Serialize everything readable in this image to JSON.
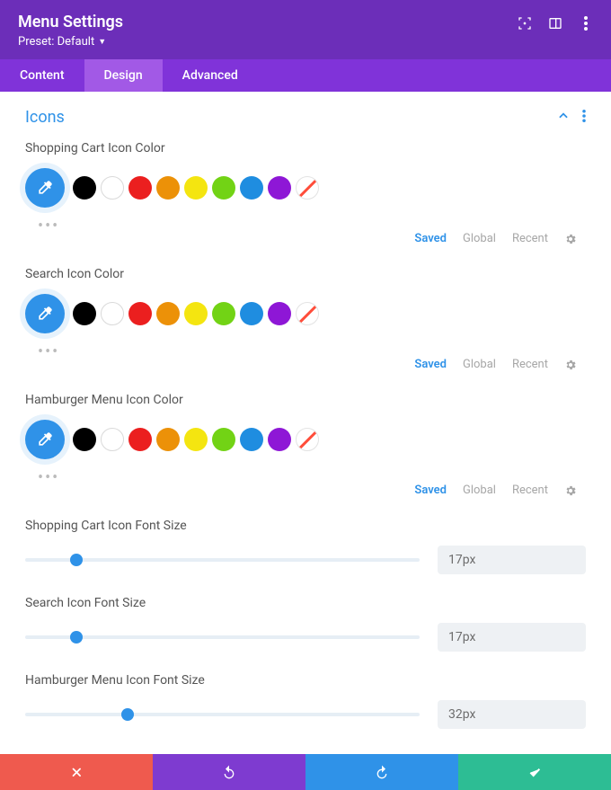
{
  "header": {
    "title": "Menu Settings",
    "preset_label": "Preset: Default"
  },
  "tabs": {
    "content": "Content",
    "design": "Design",
    "advanced": "Advanced"
  },
  "section": {
    "title": "Icons"
  },
  "swatch_palette": [
    "#000000",
    "#ffffff",
    "#eb1f1f",
    "#ec9108",
    "#f4e510",
    "#72d315",
    "#1f8de0",
    "#8e17d6"
  ],
  "color_fields": [
    {
      "label": "Shopping Cart Icon Color"
    },
    {
      "label": "Search Icon Color"
    },
    {
      "label": "Hamburger Menu Icon Color"
    }
  ],
  "palette_tabs": {
    "saved": "Saved",
    "global": "Global",
    "recent": "Recent"
  },
  "size_fields": [
    {
      "label": "Shopping Cart Icon Font Size",
      "value": "17px",
      "pos": 13
    },
    {
      "label": "Search Icon Font Size",
      "value": "17px",
      "pos": 13
    },
    {
      "label": "Hamburger Menu Icon Font Size",
      "value": "32px",
      "pos": 26
    }
  ]
}
